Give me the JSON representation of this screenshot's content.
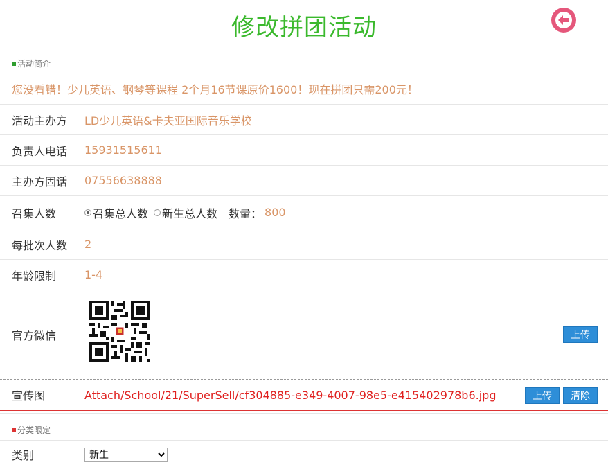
{
  "page": {
    "title": "修改拼团活动",
    "back_icon": "arrow-left-circle-icon"
  },
  "colors": {
    "title_green": "#3bb92d",
    "value_orange": "#d99567",
    "button_blue": "#2e8ed8",
    "path_red": "#e0201f",
    "back_pink": "#e5577b"
  },
  "section_intro": {
    "label": "活动简介"
  },
  "intro_text": "您没看错！少儿英语、钢琴等课程 2个月16节课原价1600！现在拼团只需200元！",
  "organizer": {
    "label": "活动主办方",
    "value": "LD少儿英语&卡夫亚国际音乐学校"
  },
  "phone": {
    "label": "负责人电话",
    "value": "15931515611"
  },
  "landline": {
    "label": "主办方固话",
    "value": "07556638888"
  },
  "recruit": {
    "label": "召集人数",
    "option_total": "召集总人数",
    "option_new": "新生总人数",
    "selected": "召集总人数",
    "qty_label": "数量：",
    "qty_value": "800"
  },
  "batch": {
    "label": "每批次人数",
    "value": "2"
  },
  "age": {
    "label": "年龄限制",
    "value": "1-4"
  },
  "wechat": {
    "label": "官方微信",
    "upload_label": "上传"
  },
  "promo": {
    "label": "宣传图",
    "path": "Attach/School/21/SuperSell/cf304885-e349-4007-98e5-e415402978b6.jpg",
    "upload_label": "上传",
    "clear_label": "清除"
  },
  "section_category": {
    "label": "分类限定"
  },
  "category": {
    "label": "类别",
    "selected": "新生"
  }
}
